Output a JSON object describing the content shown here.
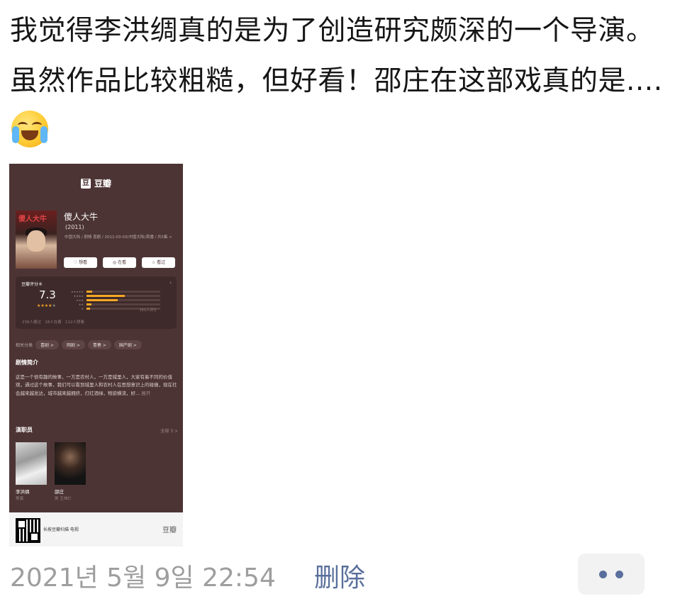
{
  "post": {
    "text": "我觉得李洪绸真的是为了创造研究颇深的一个导演。虽然作品比较粗糙，但好看！邵庄在这部戏真的是....",
    "emoji": "crying-laughing-emoji"
  },
  "card": {
    "app_name": "豆瓣",
    "logo_char": "豆",
    "poster_title": "傻人大牛",
    "title": "傻人大牛",
    "year": "(2011)",
    "meta": "中国大陆 / 剧情 喜剧 / 2011-03-03(中国大陆)首播 / 共5集 >",
    "actions": [
      "想看",
      "在看",
      "看过"
    ],
    "rating": {
      "label": "豆瓣评分®",
      "score": "7.3",
      "stars_filled": 4,
      "stars_total": 5,
      "distribution": [
        0.08,
        0.52,
        0.42,
        0.07,
        0.05
      ],
      "count": "161人评分",
      "wish": "236人看过",
      "doing": "18人在看",
      "collect": "112人想看"
    },
    "tags_label": "相关分类",
    "tags": [
      "喜剧 >",
      "网剧 >",
      "青春 >",
      "国产剧 >"
    ],
    "synopsis_title": "剧情简介",
    "synopsis": "这是一个很有趣的故事，一方是农村人，一方是城里人，大家有着不同的价值观，通过这个故事，我们可以看到城里人和农村人在思想意识上的碰撞，现在社会越来越发达，城市越来越拥挤，灯红酒绿，物欲横流，好...",
    "expand": "展开",
    "cast_title": "演职员",
    "cast_all": "全部 3 >",
    "cast": [
      {
        "name": "李洪绸",
        "role": "导演"
      },
      {
        "name": "邵庄",
        "role": "饰 王伟仁"
      }
    ],
    "footer_text": "长按豆瓣扫描 电视",
    "footer_brand": "豆瓣"
  },
  "footer": {
    "timestamp": "2021년 5월 9일 22:54",
    "delete_label": "删除"
  }
}
